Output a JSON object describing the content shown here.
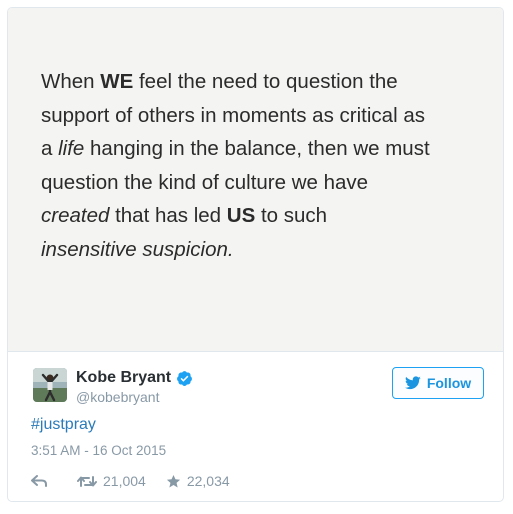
{
  "quote": {
    "l1": {
      "a": "When ",
      "b": "WE",
      "c": " feel the need to question the"
    },
    "l2": "support of others in moments as critical as",
    "l3": {
      "a": "a ",
      "b": "life",
      "c": " hanging in the balance, then we must"
    },
    "l4": "question the kind of culture we have",
    "l5": {
      "a": "created",
      "b": " that has led ",
      "c": "US",
      "d": " to such"
    },
    "l6": "insensitive suspicion."
  },
  "author": {
    "name": "Kobe Bryant",
    "handle": "@kobebryant",
    "verified_icon": "verified-badge-icon"
  },
  "follow": {
    "label": "Follow",
    "icon": "twitter-bird-icon"
  },
  "tweet": {
    "hashtag": "#justpray",
    "timestamp": "3:51 AM - 16 Oct 2015"
  },
  "actions": {
    "reply_icon": "reply-icon",
    "retweet_icon": "retweet-icon",
    "retweet_count": "21,004",
    "like_icon": "star-icon",
    "like_count": "22,034"
  },
  "colors": {
    "accent": "#1da1f2",
    "link": "#2b7bb9",
    "muted": "#8899a6",
    "text": "#292f33",
    "quote_bg": "#f4f4f2"
  }
}
